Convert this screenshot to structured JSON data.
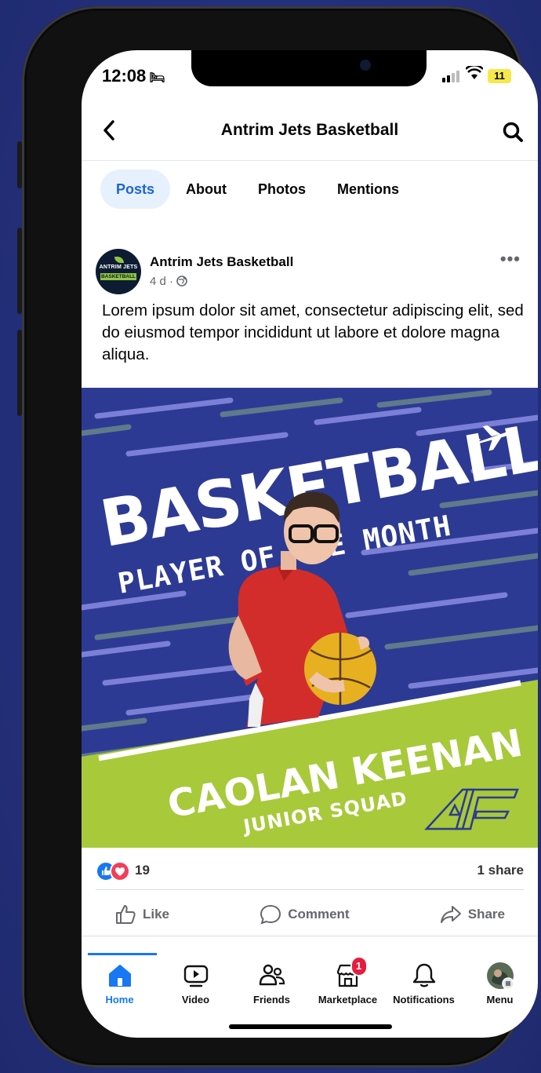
{
  "status": {
    "time": "12:08",
    "battery": "11"
  },
  "nav": {
    "title": "Antrim Jets Basketball"
  },
  "tabs": [
    {
      "label": "Posts"
    },
    {
      "label": "About"
    },
    {
      "label": "Photos"
    },
    {
      "label": "Mentions"
    }
  ],
  "post": {
    "author": "Antrim Jets Basketball",
    "avatar_line1": "ANTRIM JETS",
    "avatar_line2": "BASKETBALL",
    "age": "4 d · ",
    "text": "Lorem ipsum dolor sit amet, consectetur adipiscing elit, sed do eiusmod tempor incididunt ut labore et dolore magna aliqua.",
    "graphic": {
      "headline": "BASKETBALL",
      "subhead": "PLAYER OF THE MONTH",
      "player_name": "CAOLAN KEENAN",
      "squad": "JUNIOR SQUAD"
    },
    "reaction_count": "19",
    "shares": "1 share"
  },
  "actions": {
    "like": "Like",
    "comment": "Comment",
    "share": "Share"
  },
  "bottom_nav": [
    {
      "label": "Home"
    },
    {
      "label": "Video"
    },
    {
      "label": "Friends"
    },
    {
      "label": "Marketplace",
      "badge": "1"
    },
    {
      "label": "Notifications"
    },
    {
      "label": "Menu"
    }
  ],
  "colors": {
    "accent": "#1877f2",
    "graphic_blue": "#2d3a94",
    "graphic_green": "#a8c93a",
    "love": "#f33e58"
  }
}
